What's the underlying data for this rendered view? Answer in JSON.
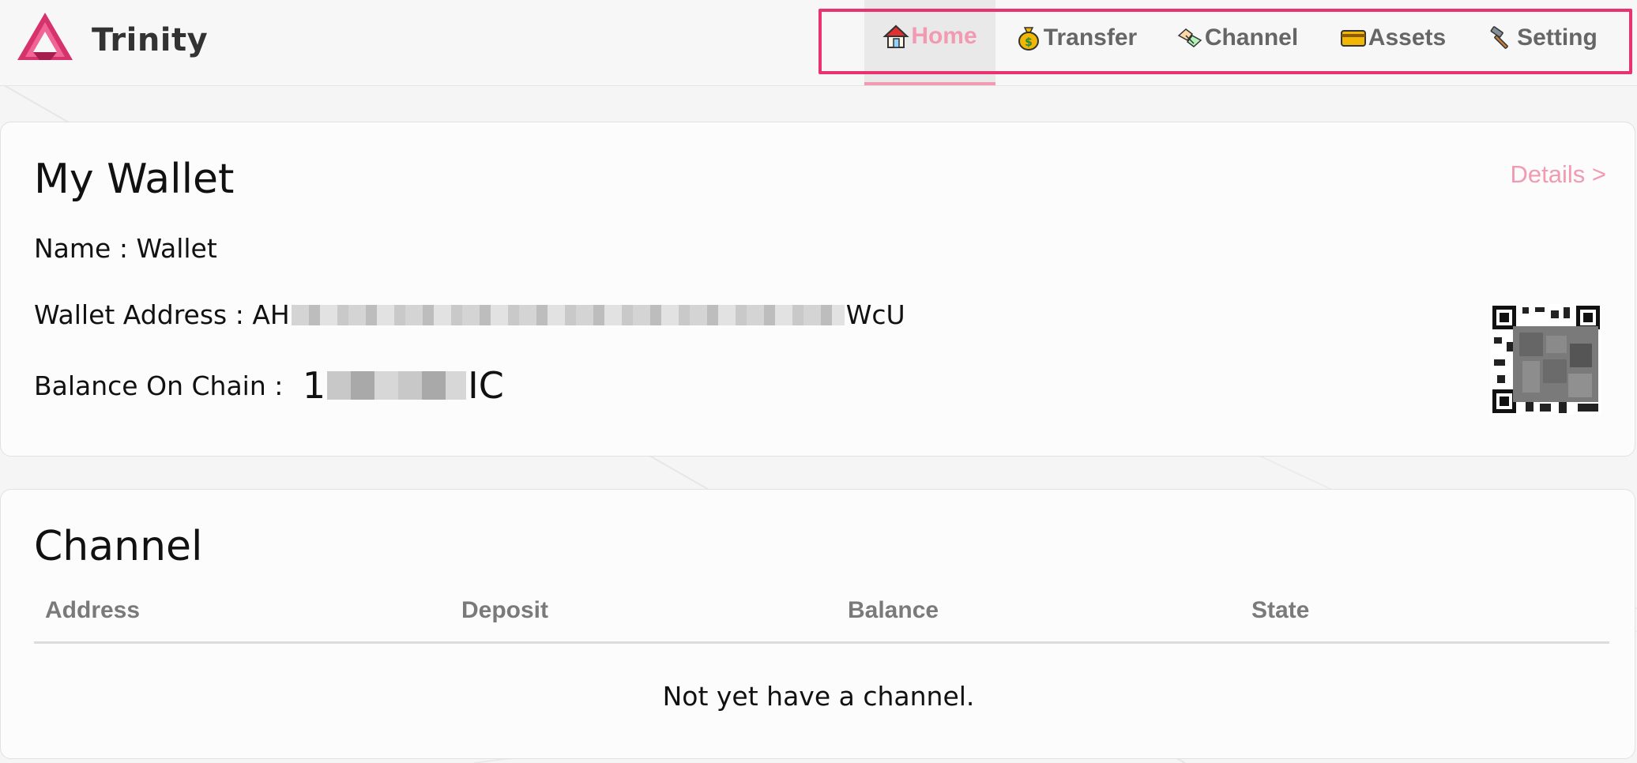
{
  "app": {
    "brand": "Trinity"
  },
  "nav": {
    "items": [
      {
        "label": "Home",
        "icon": "house-icon",
        "active": true
      },
      {
        "label": "Transfer",
        "icon": "money-bag-icon",
        "active": false
      },
      {
        "label": "Channel",
        "icon": "handshake-icon",
        "active": false
      },
      {
        "label": "Assets",
        "icon": "credit-card-icon",
        "active": false
      },
      {
        "label": "Setting",
        "icon": "hammer-icon",
        "active": false
      }
    ]
  },
  "wallet": {
    "title": "My Wallet",
    "details_link": "Details >",
    "name_label": "Name : ",
    "name_value": "Wallet",
    "address_label": "Wallet Address : ",
    "address_prefix": "AH",
    "address_suffix": "WcU",
    "balance_label": "Balance On Chain : ",
    "balance_prefix": "1",
    "balance_suffix": "IC"
  },
  "channel": {
    "title": "Channel",
    "columns": [
      "Address",
      "Deposit",
      "Balance",
      "State"
    ],
    "empty_message": "Not yet have a channel."
  },
  "colors": {
    "accent": "#f29ab2",
    "highlight_border": "#e8336e",
    "logo": "#d6336c"
  }
}
